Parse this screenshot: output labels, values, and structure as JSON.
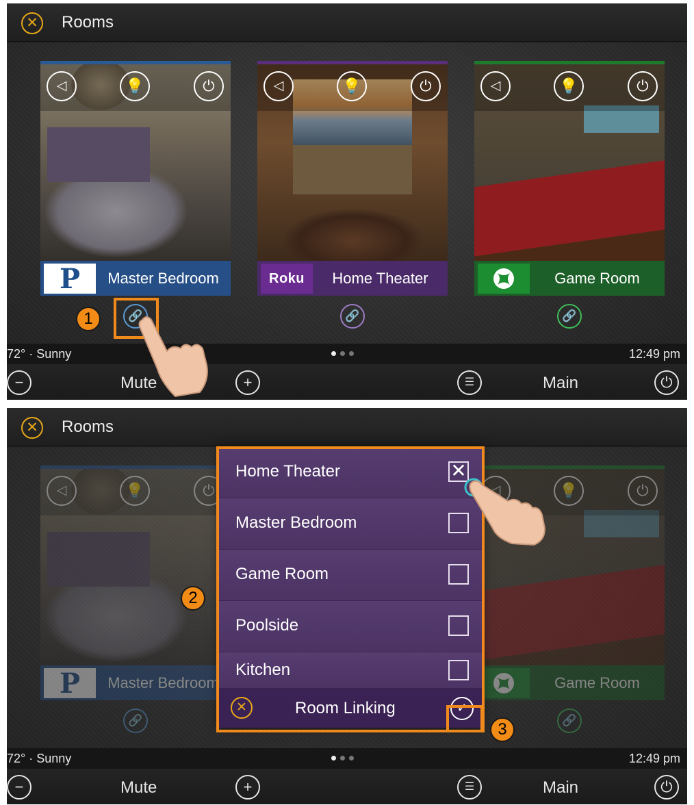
{
  "header": {
    "title": "Rooms"
  },
  "rooms": [
    {
      "name": "Master Bedroom",
      "source": "P"
    },
    {
      "name": "Home Theater",
      "source": "Roku"
    },
    {
      "name": "Game Room",
      "source": ""
    }
  ],
  "status": {
    "weather": "72° · Sunny",
    "time": "12:49 pm",
    "page_count": 3,
    "active_page": 1
  },
  "bottom": {
    "mute_label": "Mute",
    "main_label": "Main"
  },
  "popup": {
    "title": "Room Linking",
    "items": [
      {
        "label": "Home Theater",
        "checked": true
      },
      {
        "label": "Master Bedroom",
        "checked": false
      },
      {
        "label": "Game Room",
        "checked": false
      },
      {
        "label": "Poolside",
        "checked": false
      },
      {
        "label": "Kitchen",
        "checked": false
      }
    ]
  },
  "steps": [
    "1",
    "2",
    "3"
  ],
  "icons": {
    "close": "close-icon",
    "volume": "speaker-icon",
    "light": "lightbulb-icon",
    "power": "power-icon",
    "link": "link-icon",
    "minus": "minus-icon",
    "plus": "plus-icon",
    "remote": "remote-icon",
    "check": "checkmark-icon"
  },
  "colors": {
    "accent": "#e8a817",
    "highlight": "#f08a1c",
    "bedroom": "#264f87",
    "theater": "#4a2a68",
    "game": "#1d5f28",
    "popup": "#4e3566"
  }
}
